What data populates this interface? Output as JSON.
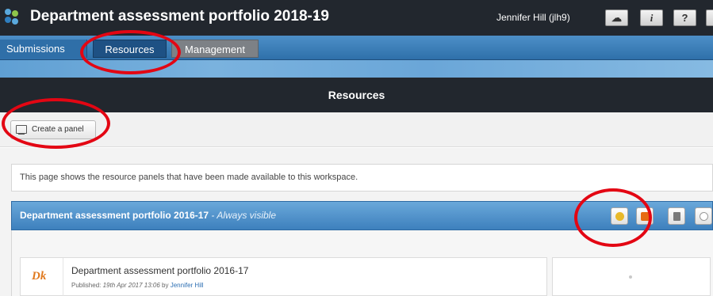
{
  "header": {
    "title": "Department assessment portfolio 2018-19",
    "title_caret": "▾",
    "user": "Jennifer Hill (jlh9)",
    "buttons": [
      {
        "name": "cloud-button",
        "label": "☁"
      },
      {
        "name": "info-button",
        "label": "i"
      },
      {
        "name": "help-button",
        "label": "?"
      }
    ]
  },
  "tabs": {
    "submissions": "Submissions",
    "resources": "Resources",
    "management": "Management"
  },
  "section": {
    "title": "Resources"
  },
  "toolbar": {
    "create_panel": "Create a panel"
  },
  "info": {
    "text": "This page shows the resource panels that have been made available to this workspace."
  },
  "panel": {
    "title": "Department assessment portfolio 2016-17",
    "visibility": " - Always visible",
    "actions": [
      {
        "name": "add-resource-icon",
        "color": "#e8b92a"
      },
      {
        "name": "settings-icon",
        "color": "#e66a12"
      },
      {
        "name": "delete-icon",
        "color": "#7a7a7a"
      },
      {
        "name": "collapse-icon",
        "color": "#b0b0b0"
      }
    ]
  },
  "item": {
    "icon": "Dk",
    "title": "Department assessment portfolio 2016-17",
    "published_label": "Published:",
    "published_date": "19th Apr 2017 13:06",
    "by": "by",
    "author": "Jennifer Hill"
  },
  "colors": {
    "annotation": "#e30613",
    "topbar": "#22272e",
    "tabbar": "#3d80bd"
  }
}
